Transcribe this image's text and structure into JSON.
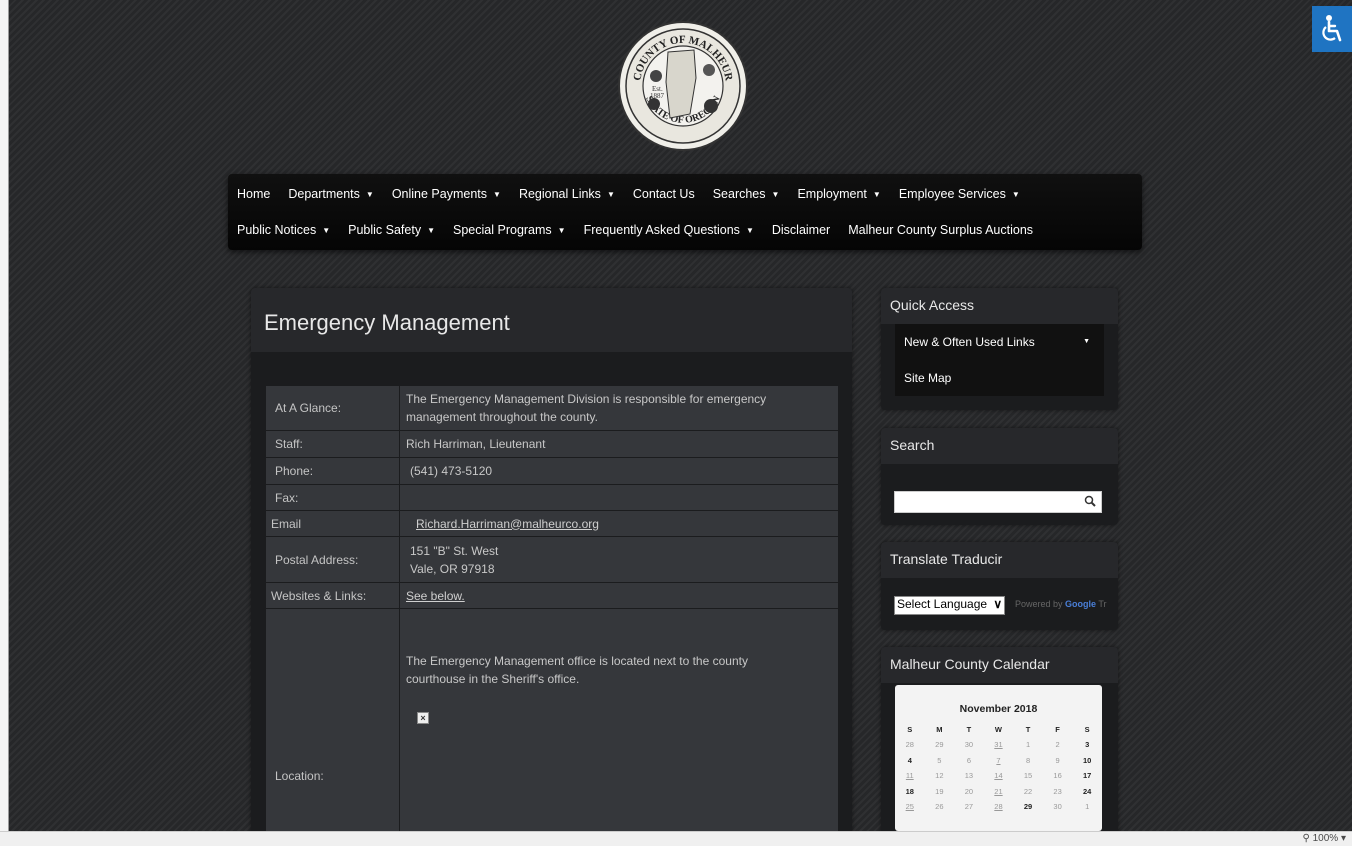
{
  "accessibility": {
    "icon": "wheelchair-icon"
  },
  "logo": {
    "text_top": "COUNTY OF MALHEUR",
    "text_bottom": "STATE OF OREGON",
    "est": "Est.",
    "year": "1887"
  },
  "nav": {
    "row1": [
      {
        "label": "Home",
        "dropdown": false
      },
      {
        "label": "Departments",
        "dropdown": true
      },
      {
        "label": "Online Payments",
        "dropdown": true
      },
      {
        "label": "Regional Links",
        "dropdown": true
      },
      {
        "label": "Contact Us",
        "dropdown": false
      },
      {
        "label": "Searches",
        "dropdown": true
      },
      {
        "label": "Employment",
        "dropdown": true
      },
      {
        "label": "Employee Services",
        "dropdown": true
      }
    ],
    "row2": [
      {
        "label": "Public Notices",
        "dropdown": true
      },
      {
        "label": "Public Safety",
        "dropdown": true
      },
      {
        "label": "Special Programs",
        "dropdown": true
      },
      {
        "label": "Frequently Asked Questions",
        "dropdown": true
      },
      {
        "label": "Disclaimer",
        "dropdown": false
      },
      {
        "label": "Malheur County Surplus Auctions",
        "dropdown": false
      }
    ],
    "caret": "▼"
  },
  "content": {
    "title": "Emergency Management",
    "rows": {
      "glance_label": "At A Glance:",
      "glance_line1": "The Emergency Management Division is responsible for emergency",
      "glance_line2": "management throughout the county.",
      "staff_label": "Staff:",
      "staff_value": "Rich Harriman, Lieutenant",
      "phone_label": "Phone:",
      "phone_value": "(541) 473-5120",
      "fax_label": "Fax:",
      "fax_value": "",
      "email_label": "Email",
      "email_value": "Richard.Harriman@malheurco.org",
      "postal_label": "Postal Address:",
      "postal_line1": "151 \"B\" St. West",
      "postal_line2": "Vale, OR 97918",
      "web_label": "Websites & Links:",
      "web_value": "See below.",
      "location_label": "Location:",
      "location_line1": "The Emergency Management office is located next to the county",
      "location_line2": "courthouse in the Sheriff's office."
    }
  },
  "sidebar": {
    "quick_access": {
      "title": "Quick Access",
      "items": [
        {
          "label": "New & Often Used Links",
          "caret": "▼"
        },
        {
          "label": "Site Map"
        }
      ]
    },
    "search": {
      "title": "Search",
      "value": ""
    },
    "translate": {
      "title": "Translate Traducir",
      "select_value": "Select Language",
      "powered_by": "Powered by",
      "google": "Google",
      "suffix": "Tr"
    },
    "calendar": {
      "title": "Malheur County Calendar",
      "month": "November 2018",
      "weekdays": [
        "S",
        "M",
        "T",
        "W",
        "T",
        "F",
        "S"
      ],
      "weeks": [
        [
          "28",
          "29",
          "30",
          "31",
          "1",
          "2",
          "3"
        ],
        [
          "4",
          "5",
          "6",
          "7",
          "8",
          "9",
          "10"
        ],
        [
          "11",
          "12",
          "13",
          "14",
          "15",
          "16",
          "17"
        ],
        [
          "18",
          "19",
          "20",
          "21",
          "22",
          "23",
          "24"
        ],
        [
          "25",
          "26",
          "27",
          "28",
          "29",
          "30",
          "1"
        ]
      ]
    }
  },
  "statusbar": {
    "zoom": "100%"
  }
}
